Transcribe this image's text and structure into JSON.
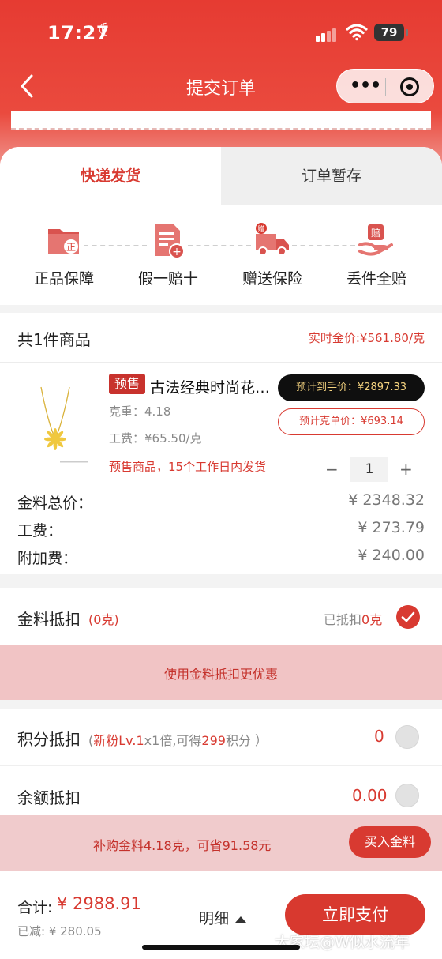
{
  "status_bar": {
    "time": "17:27",
    "battery": "79"
  },
  "nav": {
    "title": "提交订单"
  },
  "tabs": [
    {
      "label": "快递发货"
    },
    {
      "label": "订单暂存"
    }
  ],
  "guarantees": [
    {
      "label": "正品保障",
      "badge": "正",
      "icon": "certificate-folder-icon"
    },
    {
      "label": "假一赔十",
      "badge": "+",
      "icon": "document-plus-icon"
    },
    {
      "label": "赠送保险",
      "badge": "赠",
      "icon": "delivery-truck-icon"
    },
    {
      "label": "丢件全赔",
      "badge": "赔",
      "icon": "hand-compensation-icon"
    }
  ],
  "goods": {
    "count_label": "共1件商品",
    "gold_price": "实时金价:¥561.80/克",
    "product": {
      "tag": "预售",
      "name": "古法经典时尚花…",
      "weight": "克重：4.18",
      "labor": "工费：¥65.50/克",
      "presale_note": "预售商品，15个工作日内发货",
      "est_total": "预计到手价：¥2897.33",
      "est_unit": "预计克单价：¥693.14",
      "qty": "1",
      "minus": "−",
      "plus": "+"
    },
    "fees": [
      {
        "label": "金料总价：",
        "value": "¥ 2348.32"
      },
      {
        "label": "工费：",
        "value": "¥ 273.79"
      },
      {
        "label": "附加费：",
        "value": "¥ 240.00"
      }
    ]
  },
  "gold_deduct": {
    "label": "金料抵扣",
    "amount": "(0克)",
    "status_prefix": "已抵扣",
    "status_value": "0克",
    "promo": "使用金料抵扣更优惠"
  },
  "points": {
    "label": "积分抵扣",
    "info_prefix": "新粉Lv.1",
    "info_mult": "x1倍",
    "info_get": ",可得",
    "info_pts": "299",
    "info_suffix": "积分 ）",
    "value": "0"
  },
  "balance": {
    "label": "余额抵扣",
    "value": "0.00"
  },
  "buy_gold": {
    "text": "补购金料4.18克，可省91.58元",
    "button": "买入金料"
  },
  "footer": {
    "total_label": "合计:",
    "total_value": "¥ 2988.91",
    "saved": "已减: ¥ 280.05",
    "detail": "明细",
    "pay": "立即支付"
  },
  "watermark": "大家坛@W似水流年",
  "colors": {
    "brand": "#d83a31",
    "pink": "#f1c4c5"
  }
}
